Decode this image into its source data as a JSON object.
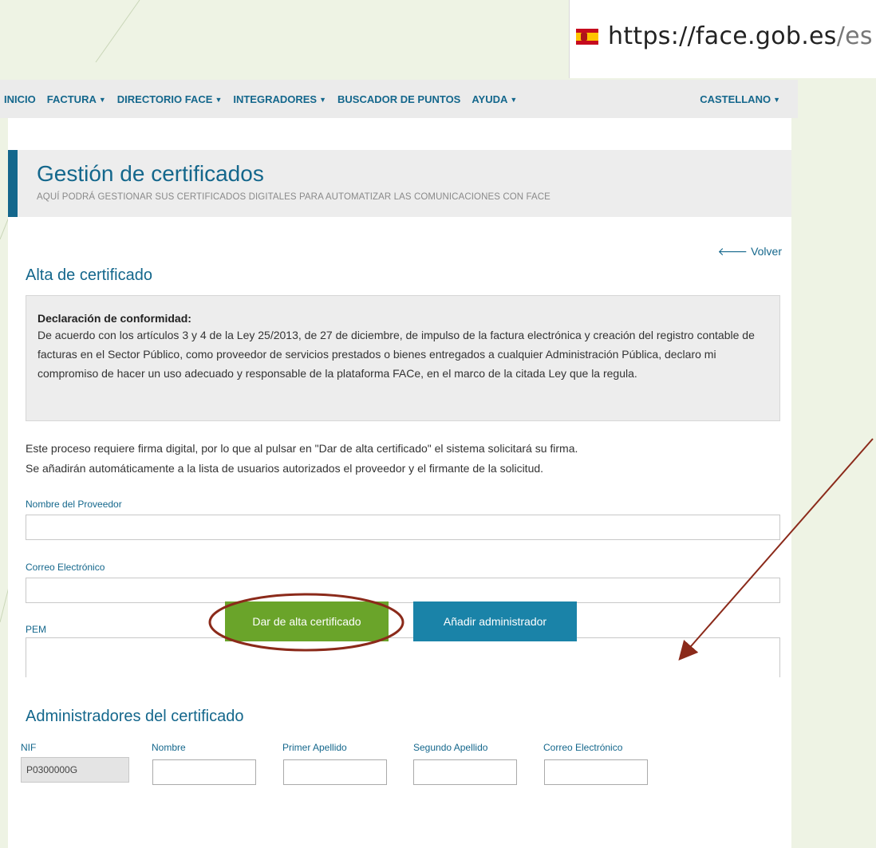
{
  "browser": {
    "url_host": "https://face.gob.es",
    "url_path": "/es"
  },
  "nav": {
    "items": [
      {
        "label": "INICIO",
        "has_dropdown": false
      },
      {
        "label": "FACTURA",
        "has_dropdown": true
      },
      {
        "label": "DIRECTORIO FACE",
        "has_dropdown": true
      },
      {
        "label": "INTEGRADORES",
        "has_dropdown": true
      },
      {
        "label": "BUSCADOR DE PUNTOS",
        "has_dropdown": false
      },
      {
        "label": "AYUDA",
        "has_dropdown": true
      }
    ],
    "language": "CASTELLANO",
    "caret": "▼"
  },
  "header": {
    "title": "Gestión de certificados",
    "subtitle": "AQUÍ PODRÁ GESTIONAR SUS CERTIFICADOS DIGITALES PARA AUTOMATIZAR LAS COMUNICACIONES CON FACE"
  },
  "back_link": {
    "arrow": "🡐",
    "label": "Volver"
  },
  "alta": {
    "title": "Alta de certificado",
    "declaration_title": "Declaración de conformidad:",
    "declaration_text": "De acuerdo con los artículos 3 y 4 de la Ley 25/2013, de 27 de diciembre, de impulso de la factura electrónica y creación del registro contable de facturas en el Sector Público, como proveedor de servicios prestados o bienes entregados a cualquier Administración Pública, declaro mi compromiso de hacer un uso adecuado y responsable de la plataforma FACe, en el marco de la citada Ley que la regula.",
    "info_line_1": "Este proceso requiere firma digital, por lo que al pulsar en \"Dar de alta certificado\" el sistema solicitará su firma.",
    "info_line_2": "Se añadirán automáticamente a la lista de usuarios autorizados el proveedor y el firmante de la solicitud.",
    "fields": {
      "proveedor_label": "Nombre del Proveedor",
      "proveedor_value": "",
      "email_label": "Correo Electrónico",
      "email_value": "",
      "pem_label": "PEM",
      "pem_value": ""
    }
  },
  "admins": {
    "title": "Administradores del certificado",
    "columns": [
      "NIF",
      "Nombre",
      "Primer Apellido",
      "Segundo Apellido",
      "Correo Electrónico"
    ],
    "row": {
      "nif": "P0300000G",
      "nombre": "",
      "primer_apellido": "",
      "segundo_apellido": "",
      "correo": ""
    }
  },
  "buttons": {
    "submit": "Dar de alta certificado",
    "add_admin": "Añadir administrador"
  },
  "colors": {
    "brand_blue": "#14678c",
    "button_green": "#6aa42a",
    "button_blue": "#1a83a8",
    "annotation_red": "#8b2a1a",
    "background": "#eef3e4"
  },
  "annotations": {
    "submit_circle": "highlight around the submit button",
    "arrow": "arrow pointing to the PEM field"
  }
}
